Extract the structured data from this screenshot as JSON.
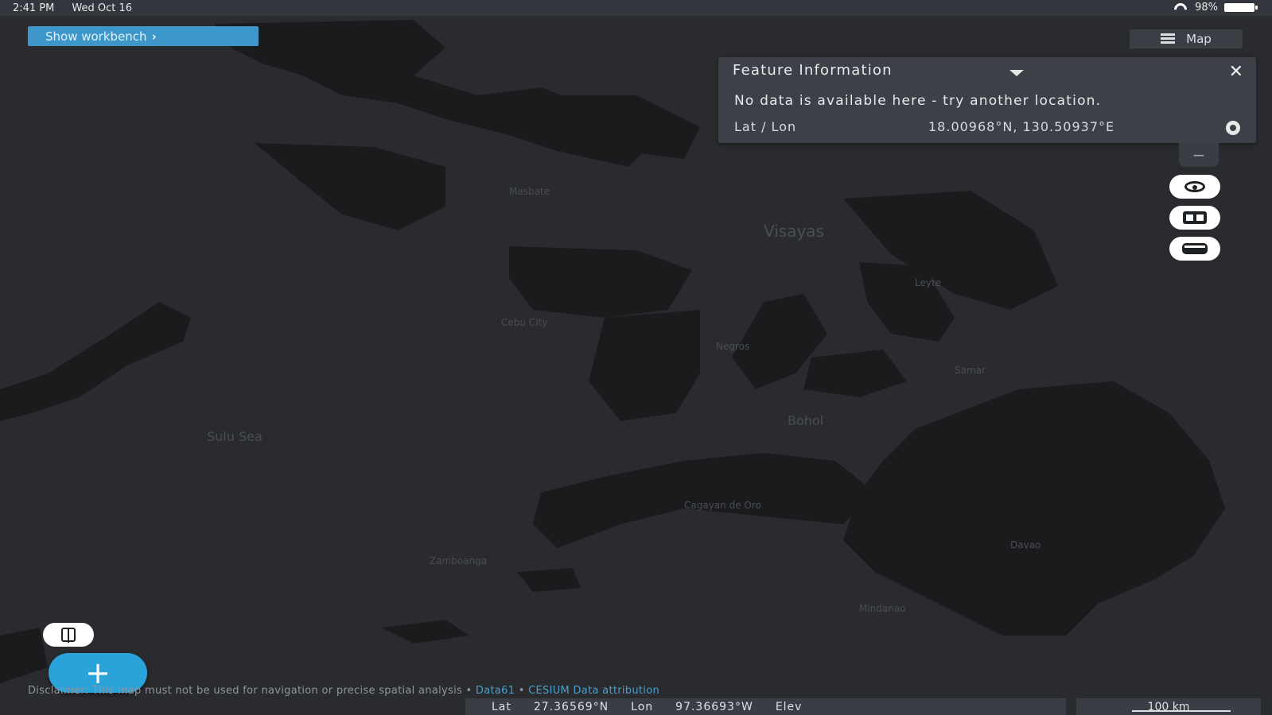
{
  "status_bar": {
    "time": "2:41 PM",
    "date": "Wed Oct 16",
    "battery": "98%",
    "icons": [
      "wifi-icon",
      "battery-icon"
    ]
  },
  "workbench": {
    "label": "Show workbench",
    "chevron": "›"
  },
  "map_toggle": {
    "label": "Map",
    "icon": "layers-icon"
  },
  "feature_info": {
    "title": "Feature Information",
    "message": "No data is available here - try another location.",
    "latlon_label": "Lat / Lon",
    "latlon_value": "18.00968°N, 130.50937°E",
    "close_icon": "close-icon",
    "pin_icon": "location-pin-icon"
  },
  "controls": {
    "zoom_out_label": "−",
    "buttons": [
      "eye-icon",
      "split-screen-icon",
      "vr-icon"
    ]
  },
  "map_labels": {
    "province_1": "Masbate",
    "region_visayas": "Visayas",
    "bohol": "Bohol",
    "cebu_city": "Cebu City",
    "negros": "Negros",
    "leyte": "Leyte",
    "samar": "Samar",
    "mindanao": "Mindanao",
    "davao": "Davao",
    "zamboanga": "Zamboanga",
    "cagayan": "Cagayan de Oro",
    "sea": "Sulu Sea"
  },
  "fab": {
    "label": "+"
  },
  "disclaimer": {
    "text": "Disclaimer: This map must not be used for navigation or precise spatial analysis •",
    "link1": "Data61",
    "sep": "•",
    "link2": "CESIUM",
    "link3": "Data attribution"
  },
  "coordinates": {
    "lat_label": "Lat",
    "lat_value": "27.36569°N",
    "lon_label": "Lon",
    "lon_value": "97.36693°W",
    "elev_label": "Elev"
  },
  "scale": {
    "label": "100 km"
  },
  "colors": {
    "map_bg": "#2a2b2e",
    "land": "#1a1b1d",
    "panel": "#3c4047",
    "accent": "#29a3d9",
    "workbench": "#3d97c8"
  }
}
